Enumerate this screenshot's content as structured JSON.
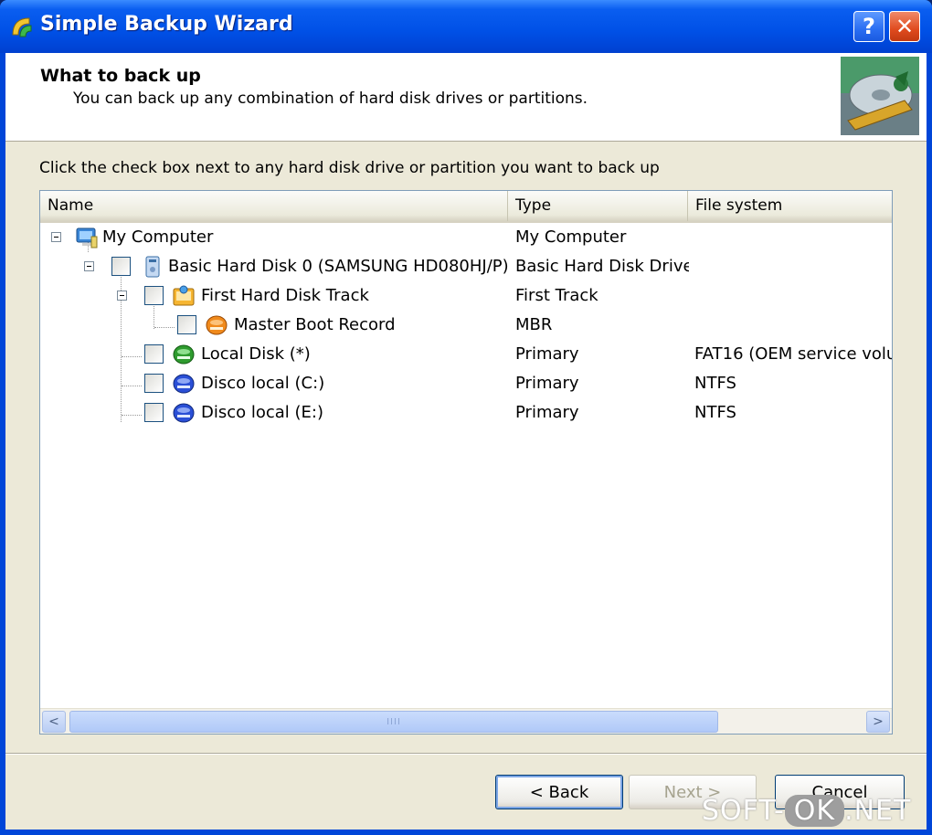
{
  "window": {
    "title": "Simple Backup Wizard",
    "help_label": "?",
    "close_label": "✕"
  },
  "header": {
    "title": "What to back up",
    "subtitle": "You can back up any combination of hard disk drives or partitions."
  },
  "instruction": "Click the check box next to any hard disk drive or partition you want to back up",
  "columns": [
    "Name",
    "Type",
    "File system"
  ],
  "rows": [
    {
      "name": "My Computer",
      "type": "My Computer",
      "fs": "",
      "icon": "computer-icon",
      "checked": false,
      "has_checkbox": false,
      "expanded": true
    },
    {
      "name": "Basic Hard Disk 0 (SAMSUNG HD080HJ/P)",
      "type": "Basic Hard Disk Drive",
      "fs": "",
      "icon": "hard-disk-icon",
      "checked": false,
      "has_checkbox": true,
      "expanded": true
    },
    {
      "name": "First Hard Disk Track",
      "type": "First Track",
      "fs": "",
      "icon": "disk-track-icon",
      "checked": false,
      "has_checkbox": true,
      "expanded": true
    },
    {
      "name": "Master Boot Record",
      "type": "MBR",
      "fs": "",
      "icon": "mbr-icon",
      "checked": false,
      "has_checkbox": true
    },
    {
      "name": "Local Disk (*)",
      "type": "Primary",
      "fs": "FAT16 (OEM service volu",
      "icon": "partition-green-icon",
      "checked": false,
      "has_checkbox": true
    },
    {
      "name": "Disco local (C:)",
      "type": "Primary",
      "fs": "NTFS",
      "icon": "partition-blue-icon",
      "checked": false,
      "has_checkbox": true
    },
    {
      "name": "Disco local (E:)",
      "type": "Primary",
      "fs": "NTFS",
      "icon": "partition-blue-icon",
      "checked": false,
      "has_checkbox": true
    }
  ],
  "scrollbar": {
    "left_arrow": "<",
    "right_arrow": ">",
    "grip": "IIII"
  },
  "buttons": {
    "back": "< Back",
    "next": "Next >",
    "cancel": "Cancel"
  },
  "watermark": {
    "pre": "SOFT-",
    "ok": "OK",
    "post": ".NET"
  },
  "colors": {
    "title_bar": "#0050e6",
    "dialog_bg": "#ece9d8",
    "green_partition": "#2e9b2e",
    "blue_partition": "#2a4fd6",
    "orange_mbr": "#f08a1c"
  }
}
